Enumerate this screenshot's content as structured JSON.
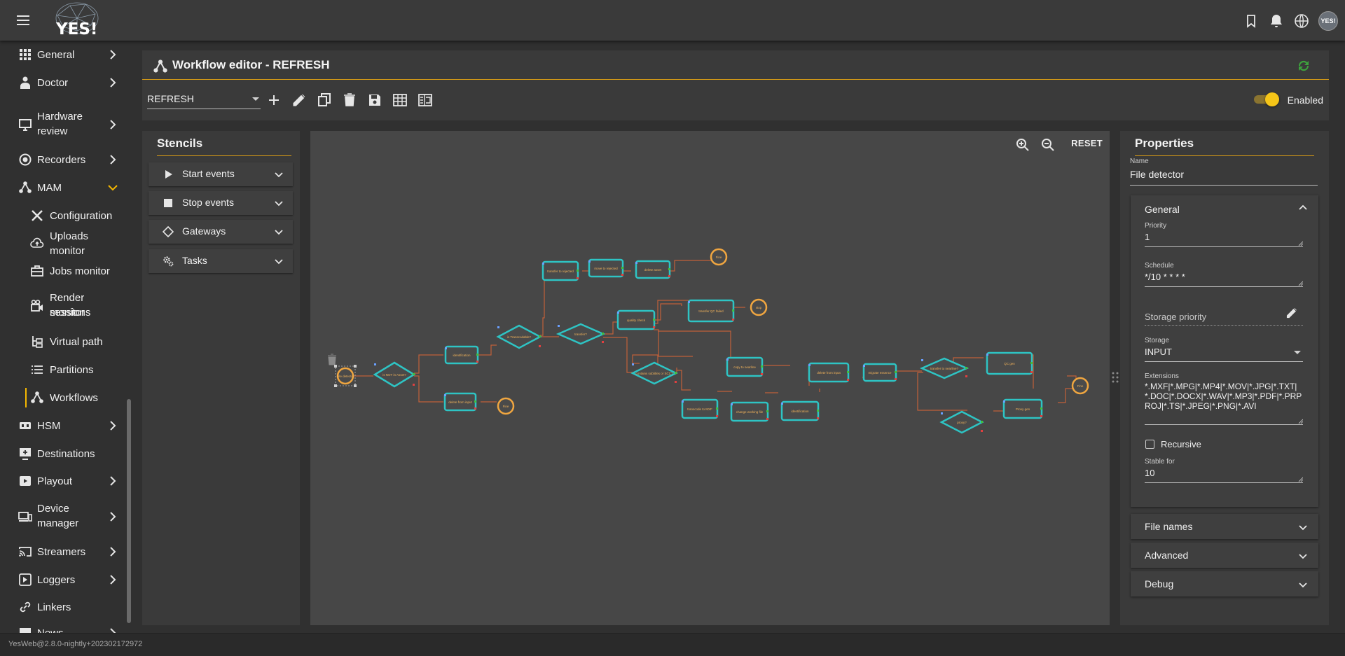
{
  "app": {
    "logo_text": "YES!",
    "avatar_text": "YES!",
    "version": "YesWeb@2.8.0-nightly+202302172972"
  },
  "sidebar": {
    "items": [
      {
        "label": "General",
        "icon": "grid-icon",
        "chevron": "right"
      },
      {
        "label": "Doctor",
        "icon": "doctor-icon",
        "chevron": "right"
      },
      {
        "label": "Hardware",
        "label2": "review",
        "icon": "hardware-icon",
        "chevron": "right"
      },
      {
        "label": "Recorders",
        "icon": "recorder-icon",
        "chevron": "right"
      },
      {
        "label": "MAM",
        "icon": "workflow-icon",
        "chevron": "down"
      },
      {
        "label": "Configuration",
        "icon": "tools-icon"
      },
      {
        "label": "Uploads monitor",
        "icon": "cloud-upload-icon"
      },
      {
        "label": "Jobs monitor",
        "icon": "jobs-icon"
      },
      {
        "label": "Render sessions",
        "label2": "monitor",
        "icon": "render-icon"
      },
      {
        "label": "Virtual path",
        "icon": "tree-icon"
      },
      {
        "label": "Partitions",
        "icon": "list-icon"
      },
      {
        "label": "Workflows",
        "icon": "workflow-icon"
      },
      {
        "label": "HSM",
        "icon": "hsm-icon",
        "chevron": "right"
      },
      {
        "label": "Destinations",
        "icon": "destination-icon"
      },
      {
        "label": "Playout",
        "icon": "play-icon",
        "chevron": "right"
      },
      {
        "label": "Device",
        "label2": "manager",
        "icon": "devices-icon",
        "chevron": "right"
      },
      {
        "label": "Streamers",
        "icon": "cast-icon",
        "chevron": "right"
      },
      {
        "label": "Loggers",
        "icon": "logger-icon",
        "chevron": "right"
      },
      {
        "label": "Linkers",
        "icon": "link-icon"
      },
      {
        "label": "News",
        "icon": "news-icon",
        "chevron": "right"
      }
    ]
  },
  "editor": {
    "title": "Workflow editor - REFRESH",
    "workflow_select": "REFRESH",
    "enabled_label": "Enabled",
    "enabled": true
  },
  "stencils": {
    "title": "Stencils",
    "items": [
      {
        "label": "Start events",
        "icon": "play-icon"
      },
      {
        "label": "Stop events",
        "icon": "stop-icon"
      },
      {
        "label": "Gateways",
        "icon": "diamond-icon"
      },
      {
        "label": "Tasks",
        "icon": "gears-icon"
      }
    ]
  },
  "canvas": {
    "reset_label": "RESET"
  },
  "diagram": {
    "nodes": [
      {
        "label": "File detector"
      },
      {
        "label": "is NOT in Asset?"
      },
      {
        "label": "identification"
      },
      {
        "label": "delete from input"
      },
      {
        "label": "Fine"
      },
      {
        "label": "is Transcodable?"
      },
      {
        "label": "transfer to rejected"
      },
      {
        "label": "move to rejected"
      },
      {
        "label": "delete asset"
      },
      {
        "label": "Fine"
      },
      {
        "label": "transfer?"
      },
      {
        "label": "quality check"
      },
      {
        "label": "transfer QC failed"
      },
      {
        "label": "stop"
      },
      {
        "label": "contains subtitles or SCC?"
      },
      {
        "label": "copy to nearline"
      },
      {
        "label": "delete from input"
      },
      {
        "label": "migrate essence"
      },
      {
        "label": "transfer to nearline?"
      },
      {
        "label": "QC gen"
      },
      {
        "label": "Fine"
      },
      {
        "label": "transcode to MXF"
      },
      {
        "label": "change working file"
      },
      {
        "label": "identification"
      },
      {
        "label": "proxy?"
      },
      {
        "label": "Proxy gen"
      }
    ]
  },
  "properties": {
    "title": "Properties",
    "name_label": "Name",
    "name_value": "File detector",
    "general": {
      "title": "General",
      "priority_label": "Priority",
      "priority_value": "1",
      "schedule_label": "Schedule",
      "schedule_value": "*/10 * * * *",
      "storage_priority_label": "Storage priority",
      "storage_label": "Storage",
      "storage_value": "INPUT",
      "extensions_label": "Extensions",
      "extensions_l1": "*.MXF|*.MPG|*.MP4|*.MOV|*.JPG|*.TXT|",
      "extensions_l2": "*.DOC|*.DOCX|*.WAV|*.MP3|*.PDF|*.PRP",
      "extensions_l3": "ROJ|*.TS|*.JPEG|*.PNG|*.AVI",
      "recursive_label": "Recursive",
      "recursive": false,
      "stable_label": "Stable for",
      "stable_value": "10"
    },
    "sections": [
      {
        "title": "File names"
      },
      {
        "title": "Advanced"
      },
      {
        "title": "Debug"
      }
    ]
  },
  "colors": {
    "accent": "#f5b700",
    "node_stroke": "#2ec4c4",
    "event_stroke": "#f0a640",
    "edge": "#c0603a"
  }
}
